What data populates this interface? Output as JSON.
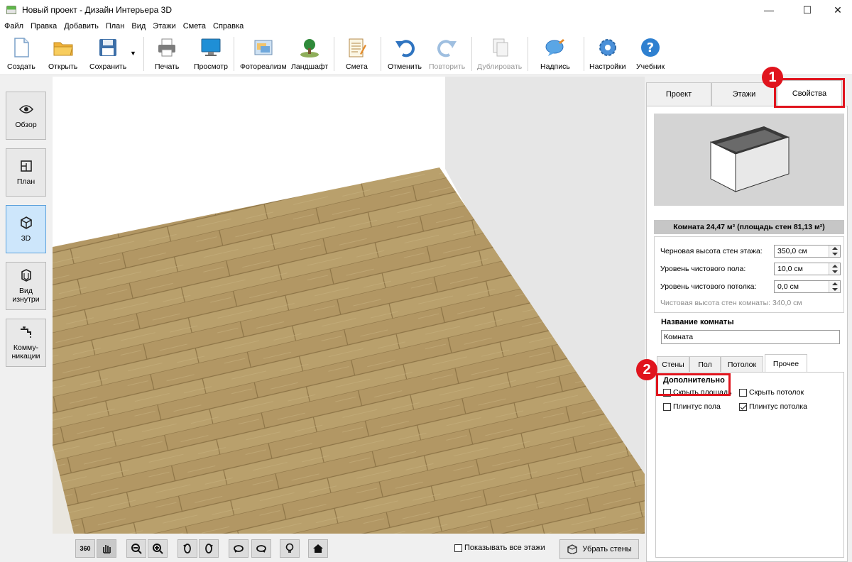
{
  "window": {
    "title": "Новый проект - Дизайн Интерьера 3D",
    "minimize": "—",
    "maximize": "☐",
    "close": "✕"
  },
  "menu": [
    "Файл",
    "Правка",
    "Добавить",
    "План",
    "Вид",
    "Этажи",
    "Смета",
    "Справка"
  ],
  "toolbar": {
    "create": "Создать",
    "open": "Открыть",
    "save": "Сохранить",
    "save_arrow": "▼",
    "print": "Печать",
    "preview": "Просмотр",
    "photoreal": "Фотореализм",
    "landscape": "Ландшафт",
    "estimate": "Смета",
    "undo": "Отменить",
    "redo": "Повторить",
    "duplicate": "Дублировать",
    "label": "Надпись",
    "settings": "Настройки",
    "tutorial": "Учебник"
  },
  "sidebar": {
    "overview": "Обзор",
    "plan": "План",
    "view3d": "3D",
    "inside": "Вид изнутри",
    "utilities": "Комму-никации"
  },
  "right_tabs": {
    "project": "Проект",
    "floors": "Этажи",
    "properties": "Свойства"
  },
  "room": {
    "caption": "Комната 24,47 м²  (площадь стен 81,13 м²)",
    "fields": [
      {
        "label": "Черновая высота стен этажа:",
        "value": "350,0 см"
      },
      {
        "label": "Уровень чистового пола:",
        "value": "10,0 см"
      },
      {
        "label": "Уровень чистового потолка:",
        "value": "0,0 см"
      }
    ],
    "clean_height": "Чистовая высота стен комнаты: 340,0 см",
    "name_title": "Название комнаты",
    "name_value": "Комната"
  },
  "sub_tabs": {
    "walls": "Стены",
    "floor": "Пол",
    "ceiling": "Потолок",
    "other": "Прочее"
  },
  "extra": {
    "title": "Дополнительно",
    "hide_area": {
      "label": "Скрыть площадь",
      "checked": false
    },
    "hide_ceiling": {
      "label": "Скрыть потолок",
      "checked": false
    },
    "floor_baseboard": {
      "label": "Плинтус пола",
      "checked": false
    },
    "ceiling_baseboard": {
      "label": "Плинтус потолка",
      "checked": true
    }
  },
  "bottom": {
    "show_all_floors": "Показывать все этажи",
    "remove_walls": "Убрать стены",
    "btn_360": "360"
  },
  "badges": {
    "one": "1",
    "two": "2"
  },
  "colors": {
    "accent": "#e0141d",
    "floor_wood": "#b49a68",
    "active_side": "#cde6fb"
  }
}
